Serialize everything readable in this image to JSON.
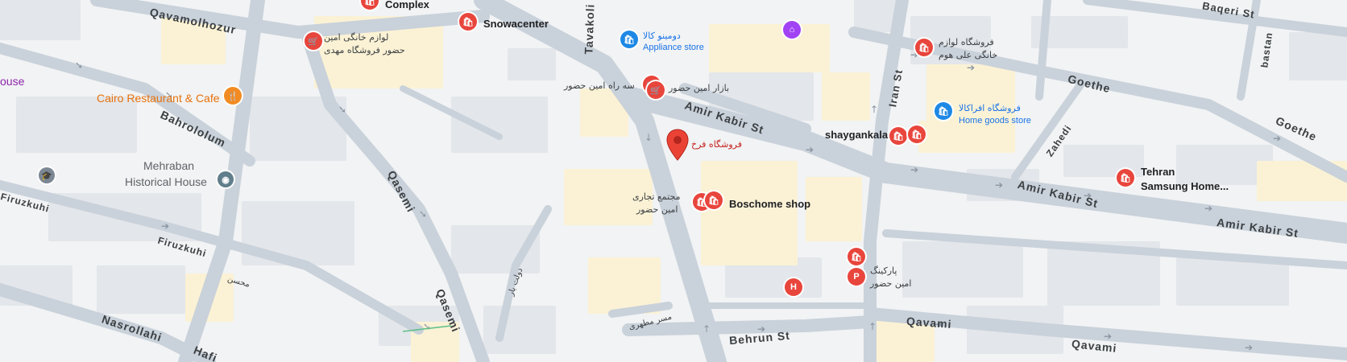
{
  "roads": {
    "qavamolhozur": "Qavamolhozur",
    "tavakoli": "Tavakoli",
    "amir_kabir_1": "Amir Kabir St",
    "amir_kabir_2": "Amir Kabir St",
    "amir_kabir_3": "Amir Kabir St",
    "iran_st": "Iran St",
    "baqeri": "Baqeri St",
    "bastan": "bastan",
    "goethe_1": "Goethe",
    "goethe_2": "Goethe",
    "zahedi": "Zahedi",
    "bahrololum": "Bahrololum",
    "qasemi_1": "Qasemi",
    "qasemi_2": "Qasemi",
    "firuzkuhi_1": "Firuzkuhi",
    "firuzkuhi_2": "Firuzkuhi",
    "nasrollahi": "Nasrollahi",
    "behrun": "Behrun St",
    "qavami_1": "Qavami",
    "qavami_2": "Qavami",
    "mohsen": "محسن",
    "dowlatyar": "دولت یار",
    "mesr": "مسر مطهری",
    "hafez_partial": "Hafi"
  },
  "pois": {
    "complex": "Complex",
    "snowacenter": "Snowacenter",
    "domino_fa": "دومینو کالا",
    "domino_en": "Appliance store",
    "lavazem_fa_1": "لوازم خانگی امین",
    "lavazem_fa_2": "حضور فروشگاه مهدی",
    "cairo": "Cairo Restaurant & Cafe",
    "house_partial": "ouse",
    "se_rah_fa": "سه راه امین حضور",
    "bazar_fa": "بازار امین حضور",
    "farokh_fa": "فروشگاه فرخ",
    "mehraban_1": "Mehraban",
    "mehraban_2": "Historical House",
    "mojtama_1": "مجتمع تجاری",
    "mojtama_2": "امین حضور",
    "boschome": "Boschome shop",
    "shaygankala": "shaygankala",
    "lavazem_home_1": "فروشگاه لوازم",
    "lavazem_home_2": "خانگی علی هوم",
    "afra_fa": "فروشگاه افراکالا",
    "afra_en": "Home goods store",
    "tehran_samsung_1": "Tehran",
    "tehran_samsung_2": "Samsung Home...",
    "parking_1": "پارکینگ",
    "parking_2": "امین حضور",
    "parking_icon": "P",
    "hospital_icon": "H"
  },
  "colors": {
    "map_bg": "#f1f3f4",
    "road": "#c9d1da",
    "road_edge": "#b6c0cb",
    "block": "#e8eaed",
    "commercial": "#fdf6dc",
    "red_poi": "#e8453c",
    "blue_poi": "#1e88e5",
    "selected_pin": "#ea4335"
  }
}
